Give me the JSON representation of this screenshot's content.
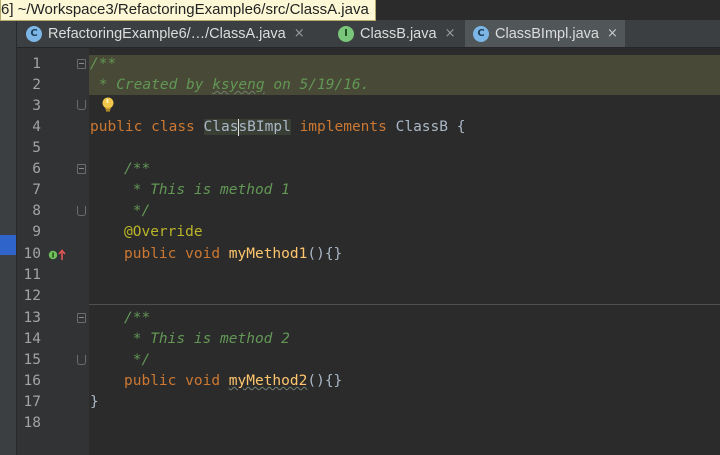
{
  "tooltip": {
    "path": "6] ~/Workspace3/RefactoringExample6/src/ClassA.java"
  },
  "tabs": [
    {
      "label": "RefactoringExample6/…/ClassA.java",
      "icon": "class-icon",
      "icon_letter": "C",
      "close": "×",
      "active": false
    },
    {
      "label": "ClassB.java",
      "icon": "interface-icon",
      "icon_letter": "I",
      "close": "×",
      "active": false
    },
    {
      "label": "ClassBImpl.java",
      "icon": "class-icon",
      "icon_letter": "C",
      "close": "×",
      "active": true
    }
  ],
  "line_numbers": [
    "1",
    "2",
    "3",
    "4",
    "5",
    "6",
    "7",
    "8",
    "9",
    "10",
    "11",
    "12",
    "13",
    "14",
    "15",
    "16",
    "17",
    "18"
  ],
  "code": {
    "l1_open": "/**",
    "l2_pre": " * Created by ",
    "l2_author": "ksyeng",
    "l2_post": " on 5/19/16.",
    "l4_public": "public",
    "l4_class": "class",
    "l4_name_a": "Clas",
    "l4_name_b": "sBImpl",
    "l4_implements": "implements",
    "l4_iface": "ClassB",
    "l4_brace": "{",
    "l6": "/**",
    "l7": " * This is method 1",
    "l8": " */",
    "l9": "@Override",
    "l10_public": "public",
    "l10_void": "void",
    "l10_name": "myMethod1",
    "l10_rest": "(){}",
    "l13": "/**",
    "l14": " * This is method 2",
    "l15": " */",
    "l16_public": "public",
    "l16_void": "void",
    "l16_name": "myMethod2",
    "l16_rest": "(){}",
    "l17": "}"
  },
  "colors": {
    "keyword": "#cc7832",
    "doc_comment": "#629755",
    "annotation": "#bbb529",
    "method": "#ffc66d",
    "text": "#a9b7c6",
    "background": "#2b2b2b"
  }
}
